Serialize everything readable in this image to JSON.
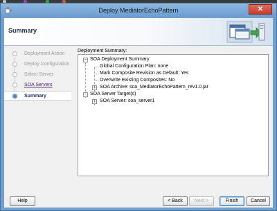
{
  "window": {
    "title": "Deploy MediatorEchoPattern",
    "close_label": "✕"
  },
  "header": {
    "title": "Summary"
  },
  "steps": [
    {
      "label": "Deployment Action",
      "state": "done"
    },
    {
      "label": "Deploy Configuration",
      "state": "done"
    },
    {
      "label": "Select Server",
      "state": "done"
    },
    {
      "label": "SOA Servers",
      "state": "link"
    },
    {
      "label": "Summary",
      "state": "current"
    }
  ],
  "summary": {
    "label": "Deployment Summary:",
    "tree": {
      "deployment_summary": "SOA Deployment Summary",
      "config_plan": "Global Configuration Plan: none",
      "mark_default": "Mark Composite Revision as Default: Yes",
      "overwrite": "Overwrite Existing Composites: No",
      "archive": "SOA Archive: sca_MediatorEchoPattern_rev1.0.jar",
      "server_targets": "SOA Server Target(s)",
      "server": "SOA Server: soa_server1"
    }
  },
  "buttons": {
    "help": "Help",
    "back": "< Back",
    "next": "Next >",
    "finish": "Finish",
    "cancel": "Cancel"
  },
  "colors": {
    "window_frame": "#6fa0cf",
    "header_title": "#1e2c44",
    "current_step": "#1d2a5a",
    "link_step": "#4a2070"
  }
}
